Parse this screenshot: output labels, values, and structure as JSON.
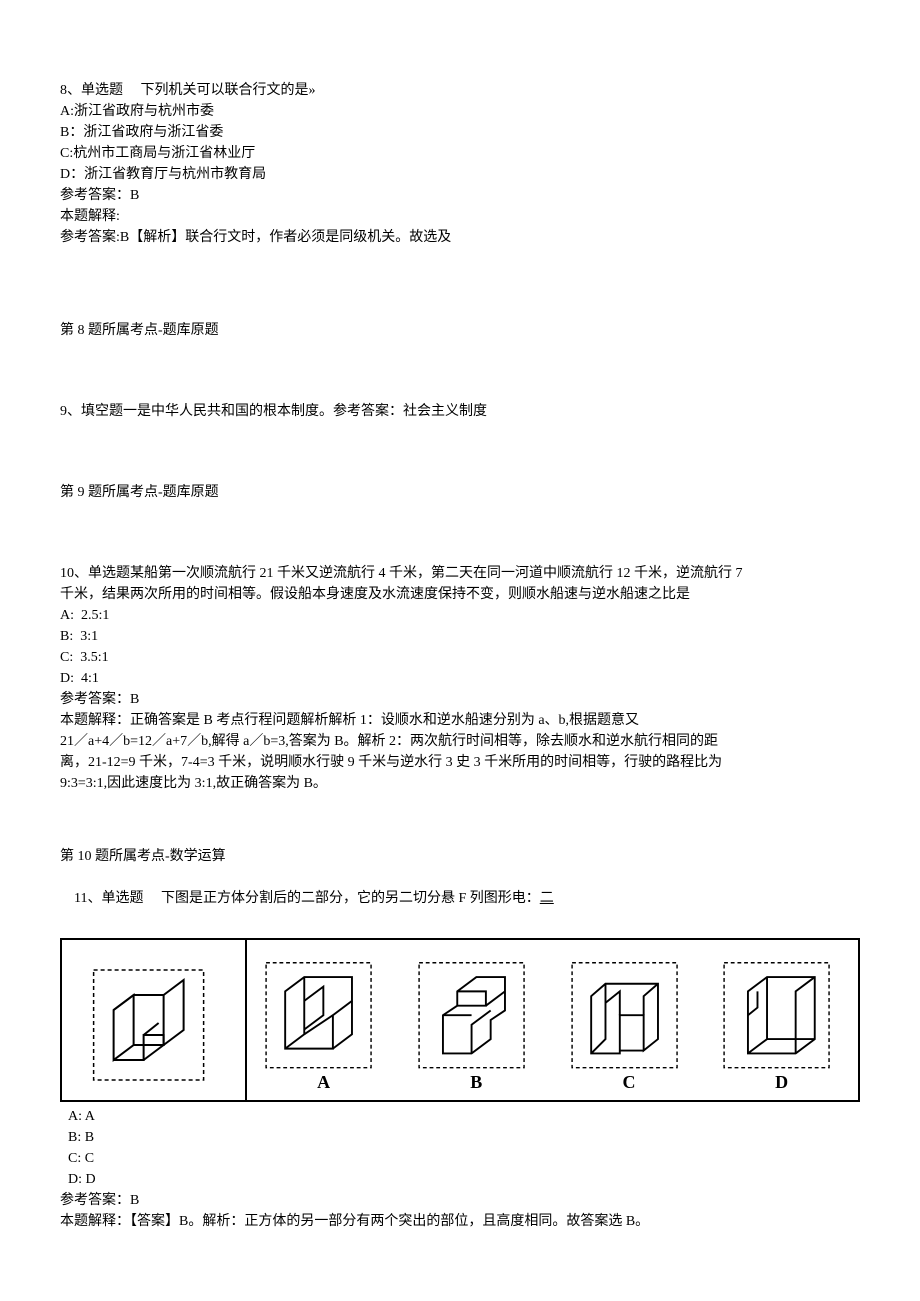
{
  "q8": {
    "prompt": "8、单选题     下列机关可以联合行文的是»",
    "a": "A:浙江省政府与杭州市委",
    "b": "B：浙江省政府与浙江省委",
    "c": "C:杭州市工商局与浙江省林业厅",
    "d": "D：浙江省教育厅与杭州市教育局",
    "ans": "参考答案：B",
    "exp1": "本题解释:",
    "exp2": "参考答案:B【解析】联合行文时，作者必须是同级机关。故选及",
    "topic": "第 8 题所属考点-题库原题"
  },
  "q9": {
    "prompt": "9、填空题一是中华人民共和国的根本制度。参考答案：社会主义制度",
    "topic": "第 9 题所属考点-题库原题"
  },
  "q10": {
    "prompt1": "10、单选题某船第一次顺流航行 21 千米又逆流航行 4 千米，第二天在同一河道中顺流航行 12 千米，逆流航行 7",
    "prompt2": "千米，结果两次所用的时间相等。假设船本身速度及水流速度保持不变，则顺水船速与逆水船速之比是",
    "a": "A:  2.5:1",
    "b": "B:  3:1",
    "c": "C:  3.5:1",
    "d": "D:  4:1",
    "ans": "参考答案：B",
    "exp1": "本题解释：正确答案是 B 考点行程问题解析解析 1：设顺水和逆水船速分别为 a、b,根据题意又",
    "exp2": "21／a+4／b=12／a+7／b,解得 a／b=3,答案为 B。解析 2：两次航行时间相等，除去顺水和逆水航行相同的距",
    "exp3": "离，21-12=9 千米，7-4=3 千米，说明顺水行驶 9 千米与逆水行 3 史 3 千米所用的时间相等，行驶的路程比为",
    "exp4": "9:3=3:1,因此速度比为 3:1,故正确答案为 B。",
    "topic": "第 10 题所属考点-数学运算"
  },
  "q11": {
    "prompt_a": "11、单选题     下图是正方体分割后的二部分，它的另二切分悬 F 列图形电：",
    "prompt_b": "二",
    "labels": {
      "a": "A",
      "b": "B",
      "c": "C",
      "d": "D"
    },
    "optA": "A: A",
    "optB": "B: B",
    "optC": "C: C",
    "optD": "D: D",
    "ans": "参考答案：B",
    "exp": "本题解释：【答案】B。解析：正方体的另一部分有两个突出的部位，且高度相同。故答案选 B。"
  }
}
